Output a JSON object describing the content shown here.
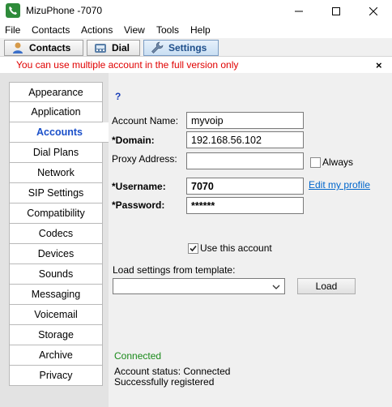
{
  "window": {
    "title": "MizuPhone -7070"
  },
  "menu": {
    "items": [
      "File",
      "Contacts",
      "Actions",
      "View",
      "Tools",
      "Help"
    ]
  },
  "toolbar": {
    "contacts_label": "Contacts",
    "dial_label": "Dial",
    "settings_label": "Settings"
  },
  "notice": {
    "text": "You can use multiple account in the full version only",
    "close_label": "×"
  },
  "sidebar": {
    "items": [
      {
        "label": "Appearance"
      },
      {
        "label": "Application"
      },
      {
        "label": "Accounts"
      },
      {
        "label": "Dial Plans"
      },
      {
        "label": "Network"
      },
      {
        "label": "SIP Settings"
      },
      {
        "label": "Compatibility"
      },
      {
        "label": "Codecs"
      },
      {
        "label": "Devices"
      },
      {
        "label": "Sounds"
      },
      {
        "label": "Messaging"
      },
      {
        "label": "Voicemail"
      },
      {
        "label": "Storage"
      },
      {
        "label": "Archive"
      },
      {
        "label": "Privacy"
      }
    ],
    "active": "Accounts"
  },
  "account": {
    "help_label": "?",
    "account_name_label": "Account Name:",
    "account_name_value": "myvoip",
    "domain_label": "*Domain:",
    "domain_value": "192.168.56.102",
    "proxy_label": "Proxy Address:",
    "proxy_value": "",
    "always_label": "Always",
    "always_checked": false,
    "username_label": "*Username:",
    "username_value": "7070",
    "edit_profile_label": "Edit my profile",
    "password_label": "*Password:",
    "password_value": "******",
    "use_account_label": "Use this account",
    "use_account_checked": true,
    "template_label": "Load settings from template:",
    "template_value": "",
    "load_label": "Load"
  },
  "status": {
    "state": "Connected",
    "state_color": "#1a8a1a",
    "line1": "Account status: Connected",
    "line2": "Successfully registered"
  },
  "colors": {
    "accent": "#1a4fc9",
    "notice": "#e00000",
    "link": "#0066cc"
  }
}
